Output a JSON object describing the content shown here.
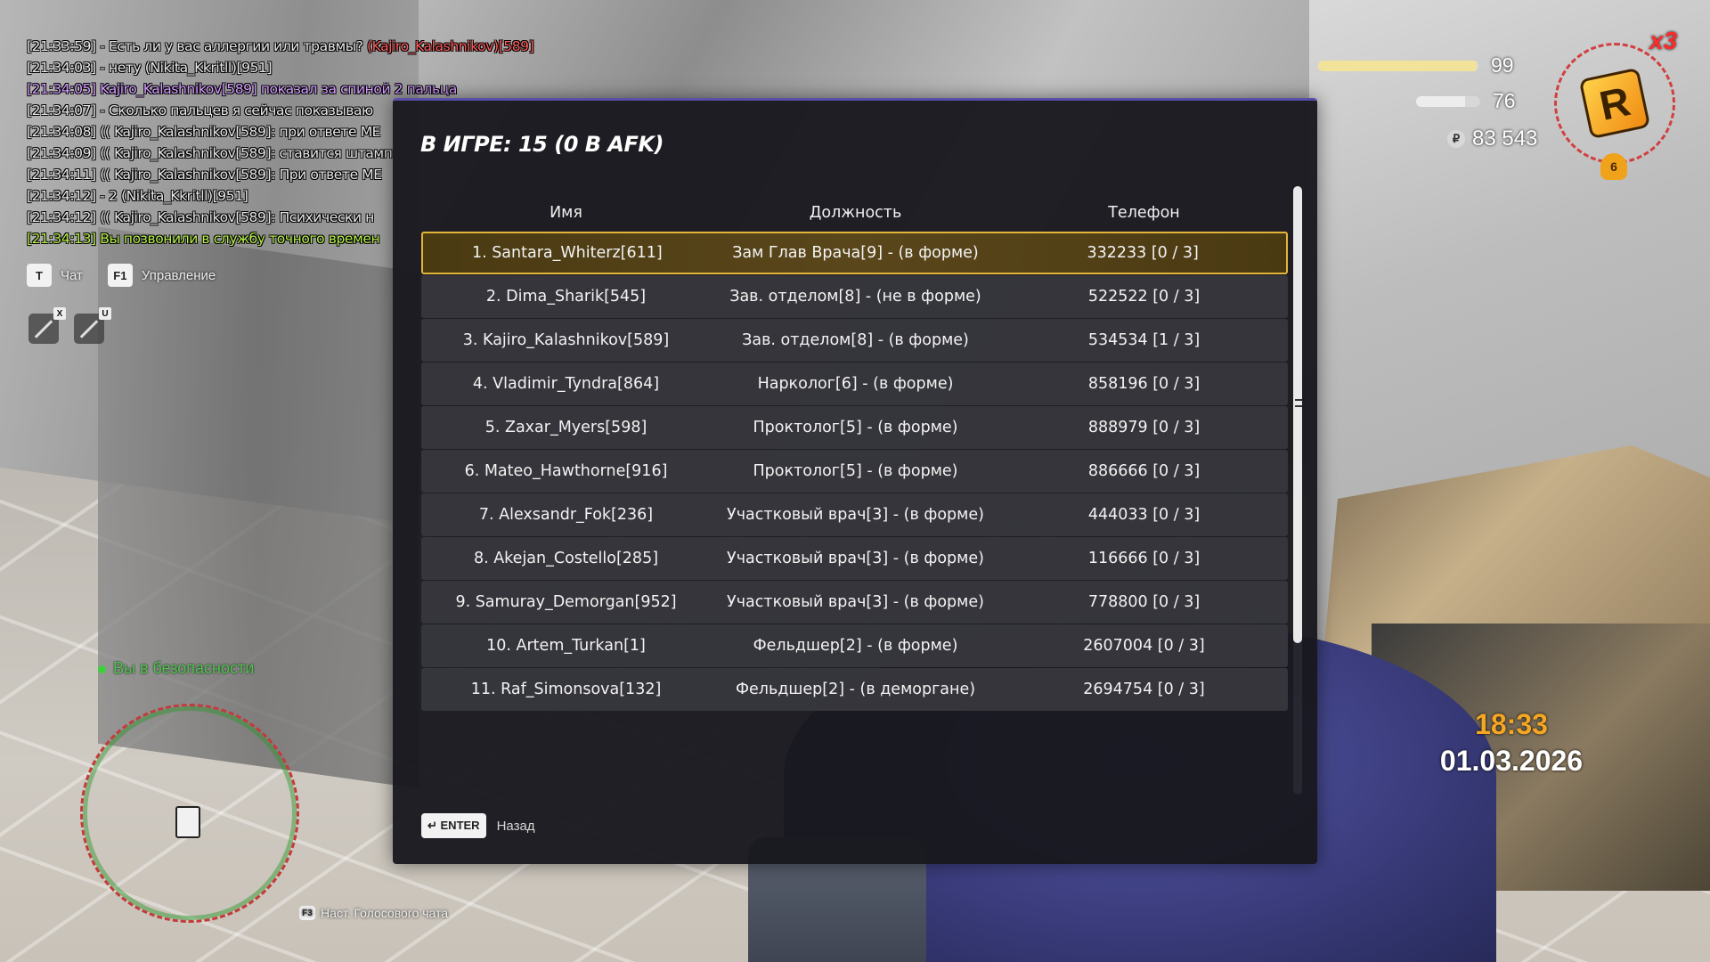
{
  "chat": [
    {
      "segments": [
        {
          "text": "[21:33:59] - Есть ли у вас аллергии или травмы? ",
          "color": "#e7e7e7"
        },
        {
          "text": "(Kajiro_Kalashnikov)[589]",
          "color": "#ff5b5b"
        }
      ]
    },
    {
      "segments": [
        {
          "text": "[21:34:03] - нету (Nikita_Kkritll)[951]",
          "color": "#e7e7e7"
        }
      ]
    },
    {
      "segments": [
        {
          "text": "[21:34:05] Kajiro_Kalashnikov[589] показал за спиной 2 пальца",
          "color": "#d49cff"
        }
      ]
    },
    {
      "segments": [
        {
          "text": "[21:34:07] - Сколько пальцев я сейчас показываю",
          "color": "#e7e7e7"
        }
      ]
    },
    {
      "segments": [
        {
          "text": "[21:34:08] (( Kajiro_Kalashnikov[589]: при ответе МЕ",
          "color": "#e7e7e7"
        }
      ]
    },
    {
      "segments": [
        {
          "text": "[21:34:09] (( Kajiro_Kalashnikov[589]: ставится штамп",
          "color": "#e7e7e7"
        }
      ]
    },
    {
      "segments": [
        {
          "text": "[21:34:11] (( Kajiro_Kalashnikov[589]: При ответе МЕ",
          "color": "#e7e7e7"
        }
      ]
    },
    {
      "segments": [
        {
          "text": "[21:34:12] - 2 (Nikita_Kkritll)[951]",
          "color": "#e7e7e7"
        }
      ]
    },
    {
      "segments": [
        {
          "text": "[21:34:12] (( Kajiro_Kalashnikov[589]: Психически н",
          "color": "#e7e7e7"
        }
      ]
    },
    {
      "segments": [
        {
          "text": "[21:34:13] Вы позвонили в службу точного времен",
          "color": "#b6f04a"
        }
      ]
    }
  ],
  "hints": {
    "chat_key": "T",
    "chat_label": "Чат",
    "control_key": "F1",
    "control_label": "Управление"
  },
  "tools": [
    {
      "key": "X",
      "icon": "mic-muted-icon"
    },
    {
      "key": "U",
      "icon": "pen-muted-icon"
    }
  ],
  "safezone": "Вы в безопасности",
  "voice": {
    "key": "F3",
    "label": "Наст. Голосового чата"
  },
  "hud": {
    "health": "99",
    "health_level": 0.99,
    "health_color": "#f1e39a",
    "armor": "76",
    "armor_level": 0.76,
    "armor_color": "#ededed",
    "money": "83 543",
    "coin_symbol": "₽",
    "multiplier": "x3",
    "logo_letter": "R",
    "bell_count": "6"
  },
  "clock": {
    "time": "18:33",
    "date": "01.03.2026"
  },
  "panel": {
    "title": "В ИГРЕ: 15 (0 В AFK)",
    "headers": {
      "name": "Имя",
      "post": "Должность",
      "phone": "Телефон"
    },
    "rows": [
      {
        "name": "1. Santara_Whiterz[611]",
        "post": "Зам Глав Врача[9] - (в форме)",
        "phone": "332233 [0 / 3]",
        "selected": true
      },
      {
        "name": "2. Dima_Sharik[545]",
        "post": "Зав. отделом[8] - (не в форме)",
        "phone": "522522 [0 / 3]"
      },
      {
        "name": "3. Kajiro_Kalashnikov[589]",
        "post": "Зав. отделом[8] - (в форме)",
        "phone": "534534 [1 / 3]"
      },
      {
        "name": "4. Vladimir_Tyndra[864]",
        "post": "Нарколог[6] - (в форме)",
        "phone": "858196 [0 / 3]"
      },
      {
        "name": "5. Zaxar_Myers[598]",
        "post": "Проктолог[5] - (в форме)",
        "phone": "888979 [0 / 3]"
      },
      {
        "name": "6. Mateo_Hawthorne[916]",
        "post": "Проктолог[5] - (в форме)",
        "phone": "886666 [0 / 3]"
      },
      {
        "name": "7. Alexsandr_Fok[236]",
        "post": "Участковый врач[3] - (в форме)",
        "phone": "444033 [0 / 3]"
      },
      {
        "name": "8. Akejan_Costello[285]",
        "post": "Участковый врач[3] - (в форме)",
        "phone": "116666 [0 / 3]"
      },
      {
        "name": "9. Samuray_Demorgan[952]",
        "post": "Участковый врач[3] - (в форме)",
        "phone": "778800 [0 / 3]"
      },
      {
        "name": "10. Artem_Turkan[1]",
        "post": "Фельдшер[2] - (в форме)",
        "phone": "2607004 [0 / 3]"
      },
      {
        "name": "11. Raf_Simonsova[132]",
        "post": "Фельдшер[2] - (в деморгане)",
        "phone": "2694754 [0 / 3]"
      }
    ],
    "footer": {
      "enter_label": "↵ ENTER",
      "back_label": "Назад"
    }
  }
}
